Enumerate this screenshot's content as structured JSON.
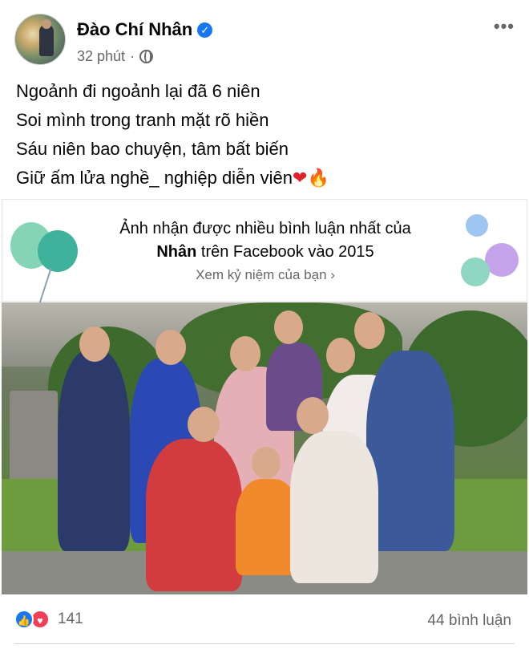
{
  "post": {
    "author": "Đào Chí Nhân",
    "time": "32 phút",
    "separator": "·",
    "more_label": "•••",
    "text_lines": [
      "Ngoảnh đi ngoảnh lại đã 6 niên",
      "Soi mình trong tranh mặt rõ hiền",
      "Sáu niên bao chuyện, tâm bất biến",
      "Giữ ấm lửa nghề_ nghiệp diễn viên"
    ],
    "emoji_heart": "❤",
    "emoji_fire": "🔥"
  },
  "memory": {
    "line1": "Ảnh nhận được nhiều bình luận nhất của",
    "name": "Nhân",
    "line2_rest": " trên Facebook vào 2015",
    "link": "Xem kỷ niệm của bạn",
    "link_chevron": "›"
  },
  "footer": {
    "reaction_count": "141",
    "comments": "44 bình luận"
  },
  "icons": {
    "verified": "verified-badge-icon",
    "privacy": "globe-icon",
    "like": "like-reaction-icon",
    "love": "love-reaction-icon"
  },
  "colors": {
    "accent": "#1877f2",
    "love": "#f33e58",
    "secondary_text": "#65676b"
  }
}
